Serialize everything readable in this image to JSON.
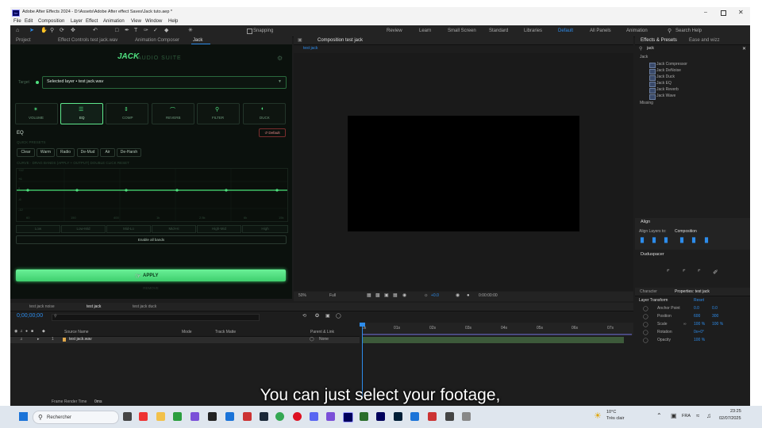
{
  "title": "Adobe After Effects 2024 - D:\\Assets\\Adobe After effect Saves\\Jack tuto.aep *",
  "menu": [
    "File",
    "Edit",
    "Composition",
    "Layer",
    "Effect",
    "Animation",
    "View",
    "Window",
    "Help"
  ],
  "snapping": "Snapping",
  "workspaces": [
    "Review",
    "Learn",
    "Small Screen",
    "Standard",
    "Libraries",
    "Default",
    "All Panels",
    "Animation"
  ],
  "search_help": "Search Help",
  "left_tabs": {
    "project": "Project",
    "effect_controls": "Effect Controls test jack.wav",
    "anim_composer": "Animation Composer",
    "jack": "Jack"
  },
  "jack": {
    "logo": "JACK",
    "suite": "AUDIO SUITE",
    "target_label": "Target",
    "selected_layer": "Selected layer • test jack.wav",
    "modes": [
      "VOLUME",
      "EQ",
      "COMP",
      "REVERB",
      "FILTER",
      "DUCK"
    ],
    "eq_title": "EQ",
    "reset": "↺ Default",
    "quick_presets_label": "QUICK PRESETS",
    "presets": [
      "Clear",
      "Warm",
      "Radio",
      "De-Mud",
      "Air",
      "De-Harsh"
    ],
    "curve_label": "CURVE · DRAG BANDS (APPLY + OUTPUT)   DOUBLE CLICK RESET",
    "y_ticks": [
      "+12",
      "+6",
      "0",
      "-6",
      "-12"
    ],
    "x_ticks": [
      "60",
      "150",
      "400",
      "1k",
      "2.5k",
      "6k",
      "15k"
    ],
    "band_buttons": [
      "Low",
      "Low-Mid",
      "Mid-Lo",
      "Mid-Hi",
      "High-Mid",
      "High"
    ],
    "enable_all": "Enable all bands",
    "apply": "APPLY",
    "remove": "REMOVE"
  },
  "comp": {
    "tab": "Composition test jack",
    "subtab": "test jack",
    "zoom": "50%",
    "quality": "Full",
    "exposure": "+0.0",
    "timecode": "0:00:00:00"
  },
  "effects": {
    "tab": "Effects & Presets",
    "tab2": "Ease and wizz",
    "search": "jack",
    "folder": "Jack",
    "items": [
      "Jack Compressor",
      "Jack DeNoise",
      "Jack Duck",
      "Jack EQ",
      "Jack Reverb",
      "Jack Wave"
    ],
    "missing": "Missing"
  },
  "align": {
    "title": "Align",
    "layers_to": "Align Layers to:",
    "target": "Composition"
  },
  "dudspacer": "Duduspacer",
  "properties": {
    "tab1": "Character",
    "tab2": "Properties: test jack",
    "layer_transform": "Layer Transform",
    "reset": "Reset",
    "rows": [
      {
        "name": "Anchor Point",
        "v1": "0.0",
        "v2": "0.0"
      },
      {
        "name": "Position",
        "v1": "600",
        "v2": "300"
      },
      {
        "name": "Scale",
        "v1": "100 %",
        "v2": "100 %"
      },
      {
        "name": "Rotation",
        "v1": "0x+0°",
        "v2": ""
      },
      {
        "name": "Opacity",
        "v1": "100 %",
        "v2": ""
      }
    ]
  },
  "timeline": {
    "tabs": [
      "test jack noise",
      "test jack",
      "test jack duck"
    ],
    "timecode": "0;00;00;00",
    "cols": {
      "source": "Source Name",
      "mode": "Mode",
      "track": "Track Matte",
      "parent": "Parent & Link"
    },
    "layer": {
      "num": "1",
      "name": "test jack.wav",
      "parent": "None"
    },
    "ruler": [
      "0s",
      "01s",
      "02s",
      "03s",
      "04s",
      "05s",
      "06s",
      "07s"
    ],
    "frame_render": "Frame Render Time",
    "frame_ms": "0ms"
  },
  "subtitle": "You can just select your footage,",
  "taskbar": {
    "search": "Rechercher",
    "weather_temp": "10°C",
    "weather_desc": "Très clair",
    "lang": "FRA",
    "time": "23:25",
    "date": "02/07/2025"
  },
  "colors": {
    "accent": "#4fe07f",
    "ae_blue": "#2d8ceb"
  }
}
